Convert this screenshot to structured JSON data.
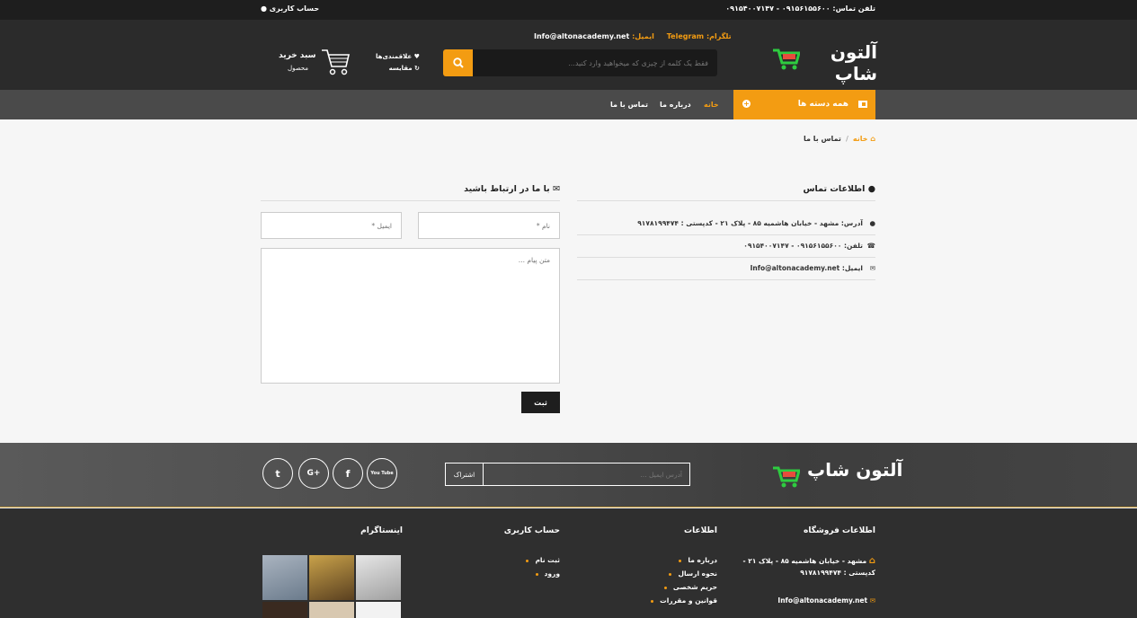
{
  "topbar": {
    "phone": "تلفن تماس: ۰۹۱۵۶۱۵۵۶۰۰ - ۰۹۱۵۴۰۰۷۱۴۷",
    "account": "حساب کاربری"
  },
  "header": {
    "logo": "آلتون شاپ",
    "telegram_label": "تلگرام:",
    "telegram_value": "Telegram",
    "email_label": "ایمیل:",
    "email_value": "Info@altonacademy.net",
    "search_placeholder": "فقط یک کلمه از چیزی که میخواهید وارد کنید...",
    "wishlist": "علاقمندی‌ها",
    "compare": "مقایسه",
    "cart_title": "سبد خرید",
    "cart_sub": "محصول"
  },
  "nav": {
    "all_categories": "همه دسته ها",
    "items": [
      "خانه",
      "درباره ما",
      "تماس با ما"
    ]
  },
  "breadcrumb": {
    "home": "خانه",
    "current": "تماس با ما"
  },
  "contact_info": {
    "title": "اطلاعات تماس",
    "address": "آدرس: مشهد - خیابان هاشمیه ۸۵ - پلاک ۲۱ - کدپستی : ۹۱۷۸۱۹۹۴۷۴",
    "phone": "تلفن: ۰۹۱۵۶۱۵۵۶۰۰ - ۰۹۱۵۴۰۰۷۱۴۷",
    "email": "ایمیل: Info@altonacademy.net"
  },
  "form": {
    "title": "با ما در ارتباط باشید",
    "name_placeholder": "نام *",
    "email_placeholder": "ایمیل *",
    "message_placeholder": "متن پیام ...",
    "submit": "ثبت"
  },
  "newsletter": {
    "placeholder": "آدرس ایمیل ...",
    "button": "اشتراک"
  },
  "social": [
    "t",
    "G+",
    "f",
    "You Tube"
  ],
  "footer": {
    "store_title": "اطلاعات فروشگاه",
    "store_address": "مشهد - خیابان هاشمیه ۸۵ - پلاک ۲۱ - کدپستی : ۹۱۷۸۱۹۹۴۷۴",
    "store_email": "Info@altonacademy.net",
    "info_title": "اطلاعات",
    "info_links": [
      "درباره ما",
      "نحوه ارسال",
      "حریم شخصی",
      "قوانین و مقررات"
    ],
    "account_title": "حساب کاربری",
    "account_links": [
      "ثبت نام",
      "ورود"
    ],
    "instagram_title": "اینستاگرام"
  },
  "colors": {
    "accent": "#f39c12",
    "dark": "#2b2b2b"
  }
}
